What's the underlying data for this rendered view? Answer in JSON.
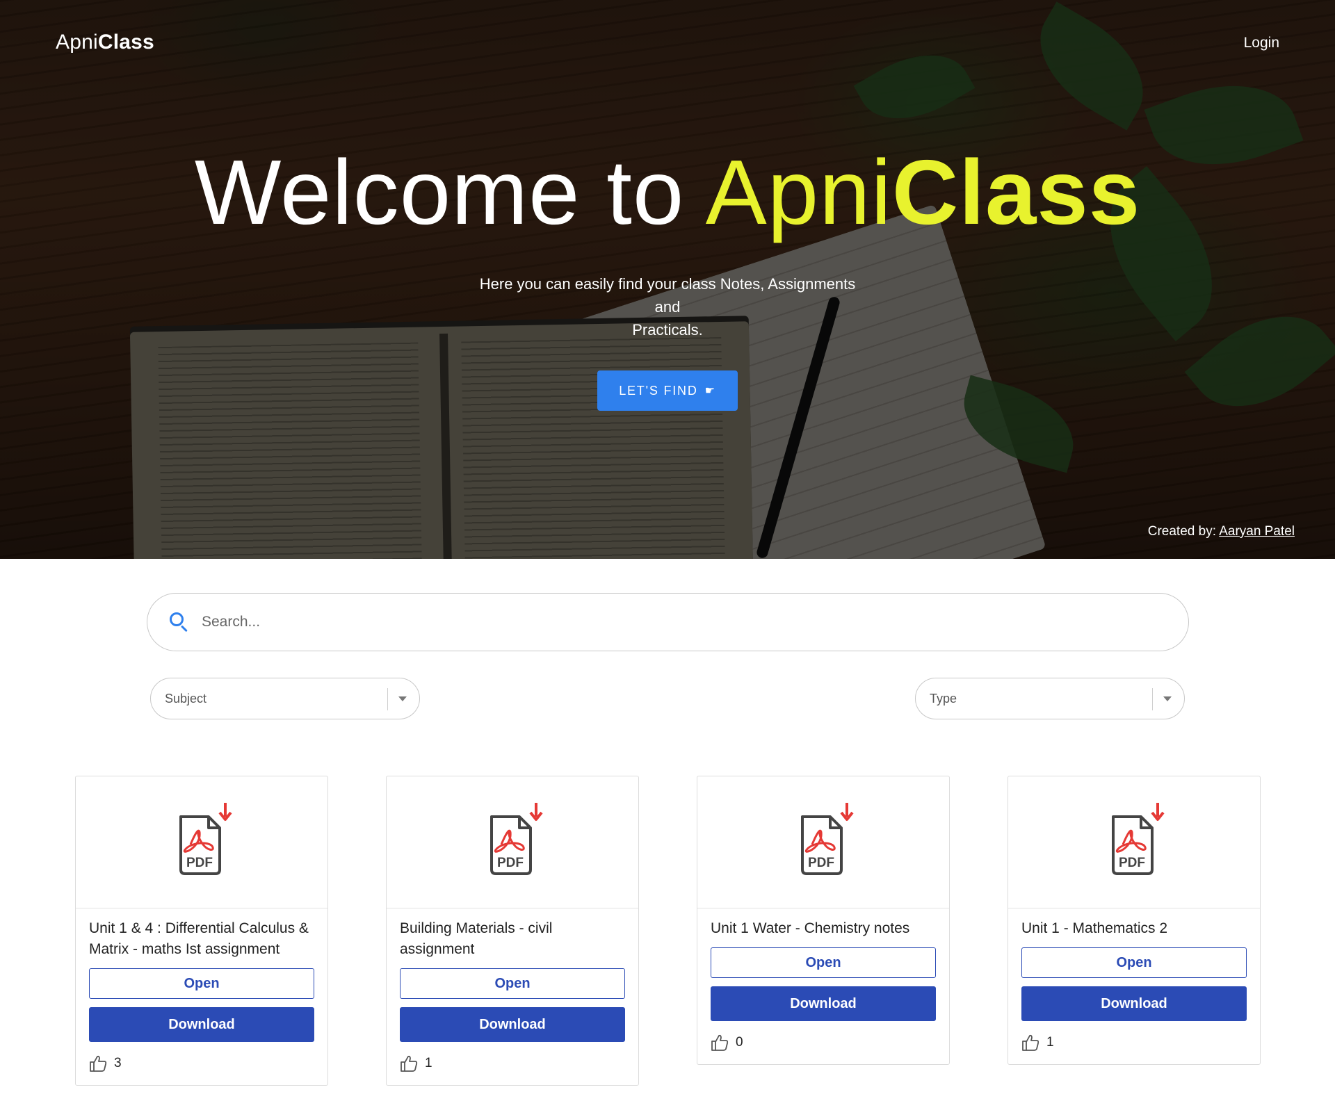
{
  "nav": {
    "brand_regular": "Apni",
    "brand_bold": "Class",
    "login": "Login"
  },
  "hero": {
    "title_welcome": "Welcome to ",
    "title_apni": "Apni",
    "title_class": "Class",
    "subtitle_line1": "Here you can easily find your class Notes, Assignments",
    "subtitle_line2": "and",
    "subtitle_line3": "Practicals.",
    "cta_label": "LET'S FIND",
    "cta_icon": "pointing-hand-icon",
    "credit_label": "Created by: ",
    "credit_name": "Aaryan Patel"
  },
  "search": {
    "placeholder": "Search...",
    "value": ""
  },
  "filters": {
    "subject_placeholder": "Subject",
    "type_placeholder": "Type"
  },
  "colors": {
    "accent_yellow": "#e8f22e",
    "cta_blue": "#2f80ed",
    "button_blue": "#2b4bb5"
  },
  "cards": [
    {
      "title": "Unit 1 & 4 : Differential Calculus & Matrix - maths Ist assignment",
      "open_label": "Open",
      "download_label": "Download",
      "likes": "3",
      "icon": "pdf-icon"
    },
    {
      "title": "Building Materials - civil assignment",
      "open_label": "Open",
      "download_label": "Download",
      "likes": "1",
      "icon": "pdf-icon"
    },
    {
      "title": "Unit 1 Water - Chemistry notes",
      "open_label": "Open",
      "download_label": "Download",
      "likes": "0",
      "icon": "pdf-icon"
    },
    {
      "title": "Unit 1 - Mathematics 2",
      "open_label": "Open",
      "download_label": "Download",
      "likes": "1",
      "icon": "pdf-icon"
    }
  ]
}
